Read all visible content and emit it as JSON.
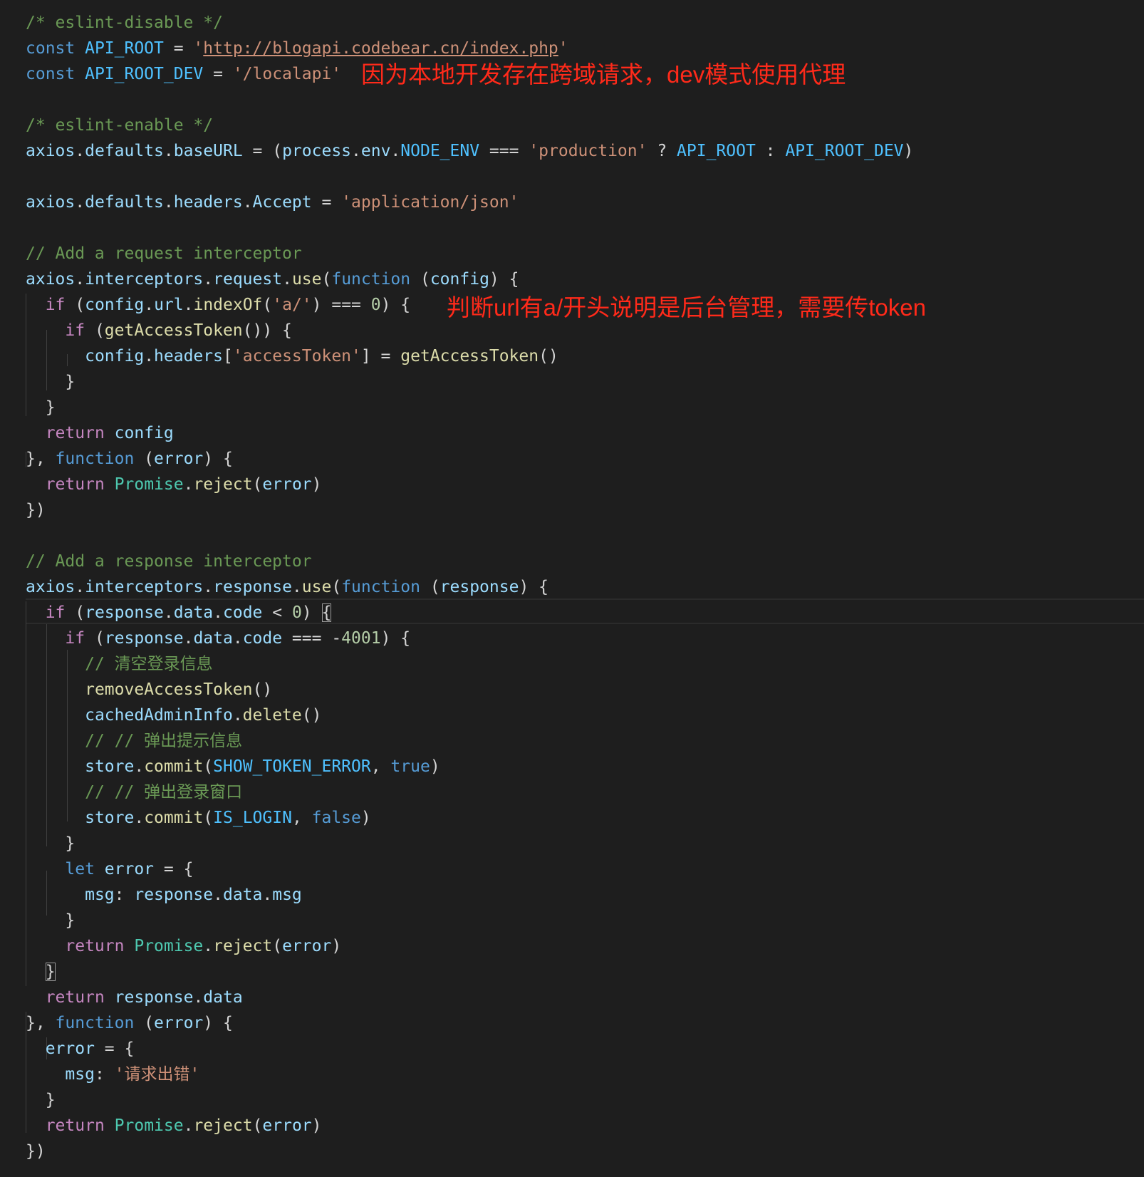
{
  "editor": {
    "colors": {
      "background": "#1e1e1e",
      "comment": "#6a9955",
      "keyword": "#569cd6",
      "control": "#c586c0",
      "string": "#ce9178",
      "variable": "#9cdcfe",
      "constant": "#4fc1ff",
      "function": "#dcdcaa",
      "class": "#4ec9b0",
      "number": "#b5cea8",
      "punctuation": "#d4d4d4",
      "annotation": "#ff2a1a"
    },
    "lines": [
      [
        [
          "t-comment",
          "/* eslint-disable */"
        ]
      ],
      [
        [
          "t-keyword",
          "const "
        ],
        [
          "t-const",
          "API_ROOT"
        ],
        [
          "t-punct",
          " = "
        ],
        [
          "t-string",
          "'"
        ],
        [
          "t-url",
          "http://blogapi.codebear.cn/index.php"
        ],
        [
          "t-string",
          "'"
        ]
      ],
      [
        [
          "t-keyword",
          "const "
        ],
        [
          "t-const",
          "API_ROOT_DEV"
        ],
        [
          "t-punct",
          " = "
        ],
        [
          "t-string",
          "'/localapi'"
        ]
      ],
      [],
      [
        [
          "t-comment",
          "/* eslint-enable */"
        ]
      ],
      [
        [
          "t-var",
          "axios"
        ],
        [
          "t-punct",
          "."
        ],
        [
          "t-var",
          "defaults"
        ],
        [
          "t-punct",
          "."
        ],
        [
          "t-var",
          "baseURL"
        ],
        [
          "t-punct",
          " = ("
        ],
        [
          "t-var",
          "process"
        ],
        [
          "t-punct",
          "."
        ],
        [
          "t-var",
          "env"
        ],
        [
          "t-punct",
          "."
        ],
        [
          "t-const",
          "NODE_ENV"
        ],
        [
          "t-punct",
          " === "
        ],
        [
          "t-string",
          "'production'"
        ],
        [
          "t-punct",
          " ? "
        ],
        [
          "t-const",
          "API_ROOT"
        ],
        [
          "t-punct",
          " : "
        ],
        [
          "t-const",
          "API_ROOT_DEV"
        ],
        [
          "t-punct",
          ")"
        ]
      ],
      [],
      [
        [
          "t-var",
          "axios"
        ],
        [
          "t-punct",
          "."
        ],
        [
          "t-var",
          "defaults"
        ],
        [
          "t-punct",
          "."
        ],
        [
          "t-var",
          "headers"
        ],
        [
          "t-punct",
          "."
        ],
        [
          "t-var",
          "Accept"
        ],
        [
          "t-punct",
          " = "
        ],
        [
          "t-string",
          "'application/json'"
        ]
      ],
      [],
      [
        [
          "t-comment",
          "// Add a request interceptor"
        ]
      ],
      [
        [
          "t-var",
          "axios"
        ],
        [
          "t-punct",
          "."
        ],
        [
          "t-var",
          "interceptors"
        ],
        [
          "t-punct",
          "."
        ],
        [
          "t-var",
          "request"
        ],
        [
          "t-punct",
          "."
        ],
        [
          "t-func",
          "use"
        ],
        [
          "t-punct",
          "("
        ],
        [
          "t-keyword",
          "function"
        ],
        [
          "t-punct",
          " ("
        ],
        [
          "t-var",
          "config"
        ],
        [
          "t-punct",
          ") {"
        ]
      ],
      [
        [
          "t-punct",
          "  "
        ],
        [
          "t-control",
          "if"
        ],
        [
          "t-punct",
          " ("
        ],
        [
          "t-var",
          "config"
        ],
        [
          "t-punct",
          "."
        ],
        [
          "t-var",
          "url"
        ],
        [
          "t-punct",
          "."
        ],
        [
          "t-func",
          "indexOf"
        ],
        [
          "t-punct",
          "("
        ],
        [
          "t-string",
          "'a/'"
        ],
        [
          "t-punct",
          ") === "
        ],
        [
          "t-number",
          "0"
        ],
        [
          "t-punct",
          ") {"
        ]
      ],
      [
        [
          "t-punct",
          "    "
        ],
        [
          "t-control",
          "if"
        ],
        [
          "t-punct",
          " ("
        ],
        [
          "t-func",
          "getAccessToken"
        ],
        [
          "t-punct",
          "()) {"
        ]
      ],
      [
        [
          "t-punct",
          "      "
        ],
        [
          "t-var",
          "config"
        ],
        [
          "t-punct",
          "."
        ],
        [
          "t-var",
          "headers"
        ],
        [
          "t-punct",
          "["
        ],
        [
          "t-string",
          "'accessToken'"
        ],
        [
          "t-punct",
          "] = "
        ],
        [
          "t-func",
          "getAccessToken"
        ],
        [
          "t-punct",
          "()"
        ]
      ],
      [
        [
          "t-punct",
          "    }"
        ]
      ],
      [
        [
          "t-punct",
          "  }"
        ]
      ],
      [
        [
          "t-punct",
          "  "
        ],
        [
          "t-control",
          "return"
        ],
        [
          "t-punct",
          " "
        ],
        [
          "t-var",
          "config"
        ]
      ],
      [
        [
          "t-punct",
          "}, "
        ],
        [
          "t-keyword",
          "function"
        ],
        [
          "t-punct",
          " ("
        ],
        [
          "t-var",
          "error"
        ],
        [
          "t-punct",
          ") {"
        ]
      ],
      [
        [
          "t-punct",
          "  "
        ],
        [
          "t-control",
          "return"
        ],
        [
          "t-punct",
          " "
        ],
        [
          "t-class",
          "Promise"
        ],
        [
          "t-punct",
          "."
        ],
        [
          "t-func",
          "reject"
        ],
        [
          "t-punct",
          "("
        ],
        [
          "t-var",
          "error"
        ],
        [
          "t-punct",
          ")"
        ]
      ],
      [
        [
          "t-punct",
          "})"
        ]
      ],
      [],
      [
        [
          "t-comment",
          "// Add a response interceptor"
        ]
      ],
      [
        [
          "t-var",
          "axios"
        ],
        [
          "t-punct",
          "."
        ],
        [
          "t-var",
          "interceptors"
        ],
        [
          "t-punct",
          "."
        ],
        [
          "t-var",
          "response"
        ],
        [
          "t-punct",
          "."
        ],
        [
          "t-func",
          "use"
        ],
        [
          "t-punct",
          "("
        ],
        [
          "t-keyword",
          "function"
        ],
        [
          "t-punct",
          " ("
        ],
        [
          "t-var",
          "response"
        ],
        [
          "t-punct",
          ") {"
        ]
      ],
      [
        [
          "t-punct",
          "  "
        ],
        [
          "t-control",
          "if"
        ],
        [
          "t-punct",
          " ("
        ],
        [
          "t-var",
          "response"
        ],
        [
          "t-punct",
          "."
        ],
        [
          "t-var",
          "data"
        ],
        [
          "t-punct",
          "."
        ],
        [
          "t-var",
          "code"
        ],
        [
          "t-punct",
          " < "
        ],
        [
          "t-number",
          "0"
        ],
        [
          "t-punct",
          ") "
        ],
        [
          "t-bracket",
          "{"
        ]
      ],
      [
        [
          "t-punct",
          "    "
        ],
        [
          "t-control",
          "if"
        ],
        [
          "t-punct",
          " ("
        ],
        [
          "t-var",
          "response"
        ],
        [
          "t-punct",
          "."
        ],
        [
          "t-var",
          "data"
        ],
        [
          "t-punct",
          "."
        ],
        [
          "t-var",
          "code"
        ],
        [
          "t-punct",
          " === -"
        ],
        [
          "t-number",
          "4001"
        ],
        [
          "t-punct",
          ") {"
        ]
      ],
      [
        [
          "t-punct",
          "      "
        ],
        [
          "t-comment",
          "// 清空登录信息"
        ]
      ],
      [
        [
          "t-punct",
          "      "
        ],
        [
          "t-func",
          "removeAccessToken"
        ],
        [
          "t-punct",
          "()"
        ]
      ],
      [
        [
          "t-punct",
          "      "
        ],
        [
          "t-var",
          "cachedAdminInfo"
        ],
        [
          "t-punct",
          "."
        ],
        [
          "t-func",
          "delete"
        ],
        [
          "t-punct",
          "()"
        ]
      ],
      [
        [
          "t-punct",
          "      "
        ],
        [
          "t-comment",
          "// // 弹出提示信息"
        ]
      ],
      [
        [
          "t-punct",
          "      "
        ],
        [
          "t-var",
          "store"
        ],
        [
          "t-punct",
          "."
        ],
        [
          "t-func",
          "commit"
        ],
        [
          "t-punct",
          "("
        ],
        [
          "t-const",
          "SHOW_TOKEN_ERROR"
        ],
        [
          "t-punct",
          ", "
        ],
        [
          "t-keyword",
          "true"
        ],
        [
          "t-punct",
          ")"
        ]
      ],
      [
        [
          "t-punct",
          "      "
        ],
        [
          "t-comment",
          "// // 弹出登录窗口"
        ]
      ],
      [
        [
          "t-punct",
          "      "
        ],
        [
          "t-var",
          "store"
        ],
        [
          "t-punct",
          "."
        ],
        [
          "t-func",
          "commit"
        ],
        [
          "t-punct",
          "("
        ],
        [
          "t-const",
          "IS_LOGIN"
        ],
        [
          "t-punct",
          ", "
        ],
        [
          "t-keyword",
          "false"
        ],
        [
          "t-punct",
          ")"
        ]
      ],
      [
        [
          "t-punct",
          "    }"
        ]
      ],
      [
        [
          "t-punct",
          "    "
        ],
        [
          "t-keyword",
          "let"
        ],
        [
          "t-punct",
          " "
        ],
        [
          "t-var",
          "error"
        ],
        [
          "t-punct",
          " = {"
        ]
      ],
      [
        [
          "t-punct",
          "      "
        ],
        [
          "t-var",
          "msg"
        ],
        [
          "t-punct",
          ": "
        ],
        [
          "t-var",
          "response"
        ],
        [
          "t-punct",
          "."
        ],
        [
          "t-var",
          "data"
        ],
        [
          "t-punct",
          "."
        ],
        [
          "t-var",
          "msg"
        ]
      ],
      [
        [
          "t-punct",
          "    }"
        ]
      ],
      [
        [
          "t-punct",
          "    "
        ],
        [
          "t-control",
          "return"
        ],
        [
          "t-punct",
          " "
        ],
        [
          "t-class",
          "Promise"
        ],
        [
          "t-punct",
          "."
        ],
        [
          "t-func",
          "reject"
        ],
        [
          "t-punct",
          "("
        ],
        [
          "t-var",
          "error"
        ],
        [
          "t-punct",
          ")"
        ]
      ],
      [
        [
          "t-punct",
          "  "
        ],
        [
          "t-bracket",
          "}"
        ]
      ],
      [
        [
          "t-punct",
          "  "
        ],
        [
          "t-control",
          "return"
        ],
        [
          "t-punct",
          " "
        ],
        [
          "t-var",
          "response"
        ],
        [
          "t-punct",
          "."
        ],
        [
          "t-var",
          "data"
        ]
      ],
      [
        [
          "t-punct",
          "}, "
        ],
        [
          "t-keyword",
          "function"
        ],
        [
          "t-punct",
          " ("
        ],
        [
          "t-var",
          "error"
        ],
        [
          "t-punct",
          ") {"
        ]
      ],
      [
        [
          "t-punct",
          "  "
        ],
        [
          "t-var",
          "error"
        ],
        [
          "t-punct",
          " = {"
        ]
      ],
      [
        [
          "t-punct",
          "    "
        ],
        [
          "t-var",
          "msg"
        ],
        [
          "t-punct",
          ": "
        ],
        [
          "t-string",
          "'请求出错'"
        ]
      ],
      [
        [
          "t-punct",
          "  }"
        ]
      ],
      [
        [
          "t-punct",
          "  "
        ],
        [
          "t-control",
          "return"
        ],
        [
          "t-punct",
          " "
        ],
        [
          "t-class",
          "Promise"
        ],
        [
          "t-punct",
          "."
        ],
        [
          "t-func",
          "reject"
        ],
        [
          "t-punct",
          "("
        ],
        [
          "t-var",
          "error"
        ],
        [
          "t-punct",
          ")"
        ]
      ],
      [
        [
          "t-punct",
          "})"
        ]
      ]
    ]
  },
  "annotations": {
    "proxy_note": "因为本地开发存在跨域请求，dev模式使用代理",
    "token_note": "判断url有a/开头说明是后台管理，需要传token"
  }
}
